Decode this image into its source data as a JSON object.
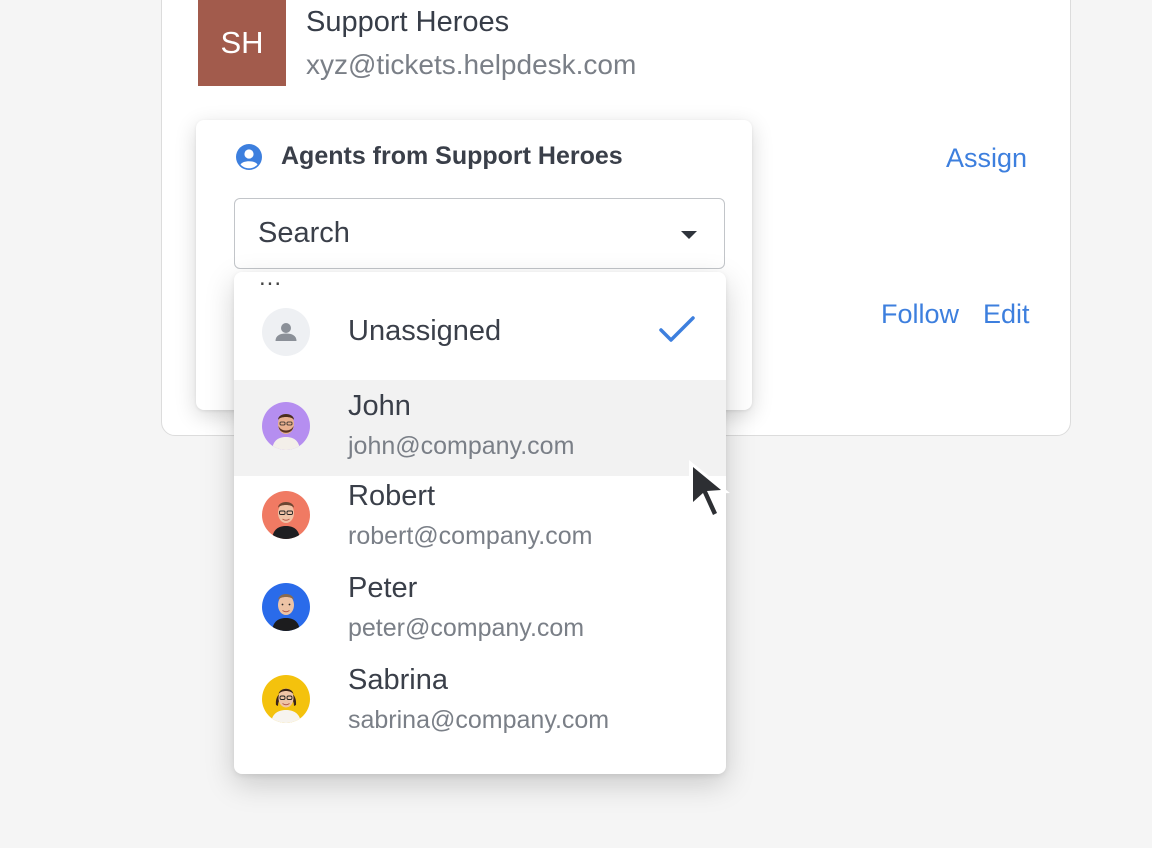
{
  "company": {
    "initials": "SH",
    "name": "Support Heroes",
    "email": "xyz@tickets.helpdesk.com",
    "avatar_color": "#a25b4c"
  },
  "actions": {
    "assign": "Assign",
    "follow": "Follow",
    "edit": "Edit",
    "link_color": "#3d7fde"
  },
  "panel": {
    "title": "Agents from Support Heroes",
    "title_icon": "user-circle-icon",
    "search": {
      "value": "Search",
      "caret_icon": "caret-down-icon"
    }
  },
  "dropdown": {
    "ellipsis": "...",
    "unassigned": {
      "label": "Unassigned",
      "selected": true,
      "icon": "person-icon"
    },
    "agents": [
      {
        "name": "John",
        "email": "john@company.com",
        "avatar_bg": "#b58ef0",
        "hovered": true
      },
      {
        "name": "Robert",
        "email": "robert@company.com",
        "avatar_bg": "#f07a63"
      },
      {
        "name": "Peter",
        "email": "peter@company.com",
        "avatar_bg": "#2a6bea"
      },
      {
        "name": "Sabrina",
        "email": "sabrina@company.com",
        "avatar_bg": "#f4c20d"
      }
    ]
  },
  "pointer": {
    "icon": "mouse-pointer-icon"
  }
}
